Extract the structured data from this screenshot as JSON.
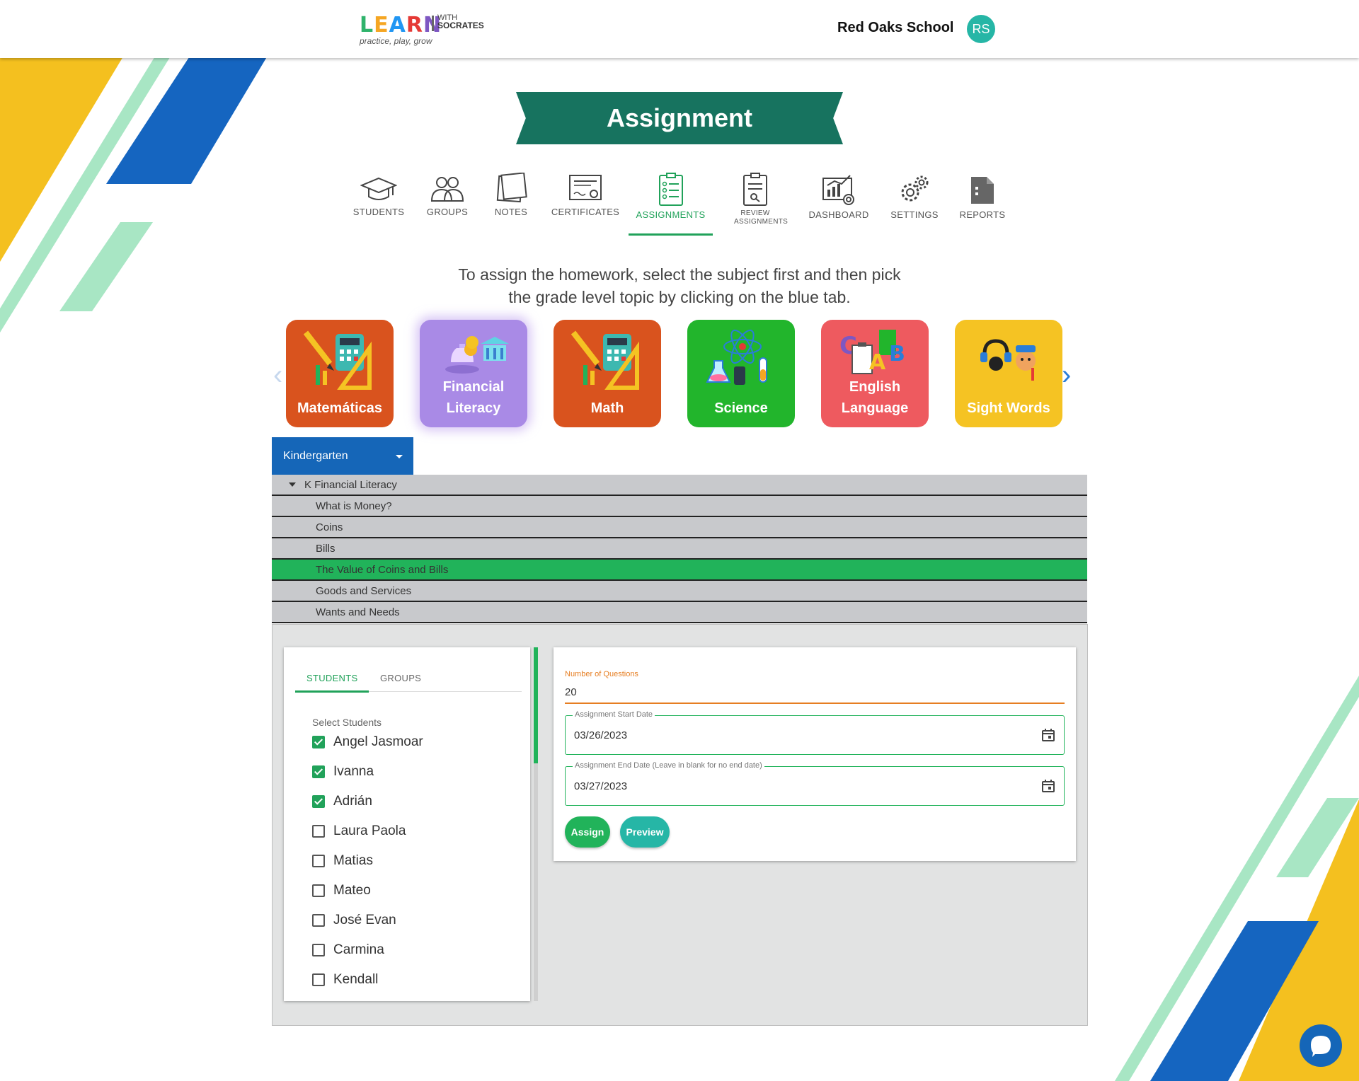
{
  "header": {
    "logo_main": [
      "L",
      "E",
      "A",
      "R",
      "N"
    ],
    "logo_with": "WITH",
    "logo_socrates": "SOCRATES",
    "logo_tagline": "practice, play, grow",
    "school_name": "Red Oaks School",
    "avatar_initials": "RS"
  },
  "page": {
    "title": "Assignment"
  },
  "nav": {
    "items": [
      {
        "label": "STUDENTS",
        "icon": "graduation-cap-icon"
      },
      {
        "label": "GROUPS",
        "icon": "users-icon"
      },
      {
        "label": "NOTES",
        "icon": "notes-icon"
      },
      {
        "label": "CERTIFICATES",
        "icon": "certificate-icon"
      },
      {
        "label": "ASSIGNMENTS",
        "icon": "clipboard-list-icon"
      },
      {
        "label": "REVIEW ASSIGNMENTS",
        "icon": "review-clipboard-icon"
      },
      {
        "label": "DASHBOARD",
        "icon": "dashboard-icon"
      },
      {
        "label": "SETTINGS",
        "icon": "gears-icon"
      },
      {
        "label": "REPORTS",
        "icon": "report-file-icon"
      }
    ],
    "active": "ASSIGNMENTS"
  },
  "intro": {
    "line1": "To assign the homework, select the subject first and then pick",
    "line2": "the grade level topic by clicking on the blue tab."
  },
  "subjects": [
    {
      "label": "Matemáticas",
      "color": "#d9531e"
    },
    {
      "label": "Financial Literacy",
      "label_line1": "Financial",
      "label_line2": "Literacy",
      "color": "#a98ae6"
    },
    {
      "label": "Math",
      "color": "#d9531e"
    },
    {
      "label": "Science",
      "color": "#22b52c"
    },
    {
      "label": "English Language",
      "label_line1": "English",
      "label_line2": "Language",
      "color": "#ee5a5f"
    },
    {
      "label": "Sight Words",
      "color": "#f5c323"
    }
  ],
  "selected_subject": "Financial Literacy",
  "grade": {
    "selected": "Kindergarten"
  },
  "topics": {
    "parent": "K Financial Literacy",
    "items": [
      "What is Money?",
      "Coins",
      "Bills",
      "The Value of Coins and Bills",
      "Goods and Services",
      "Wants and Needs"
    ],
    "selected": "The Value of Coins and Bills"
  },
  "students_panel": {
    "tabs": [
      "STUDENTS",
      "GROUPS"
    ],
    "active_tab": "STUDENTS",
    "select_label": "Select Students",
    "students": [
      {
        "name": "Angel Jasmoar",
        "checked": true
      },
      {
        "name": "Ivanna",
        "checked": true
      },
      {
        "name": "Adrián",
        "checked": true
      },
      {
        "name": "Laura Paola",
        "checked": false
      },
      {
        "name": "Matias",
        "checked": false
      },
      {
        "name": "Mateo",
        "checked": false
      },
      {
        "name": "José Evan",
        "checked": false
      },
      {
        "name": "Carmina",
        "checked": false
      },
      {
        "name": "Kendall",
        "checked": false
      }
    ]
  },
  "form": {
    "num_questions_label": "Number of Questions",
    "num_questions_value": "20",
    "start_date_label": "Assignment Start Date",
    "start_date_value": "03/26/2023",
    "end_date_label": "Assignment End Date (Leave in blank for no end date)",
    "end_date_value": "03/27/2023",
    "assign_label": "Assign",
    "preview_label": "Preview"
  },
  "colors": {
    "accent_green": "#21a25a",
    "banner_green": "#17735f",
    "grade_blue": "#1566b8",
    "deco_yellow": "#f4c01f",
    "deco_blue": "#1565c0",
    "deco_mint": "#a8e6c4"
  }
}
